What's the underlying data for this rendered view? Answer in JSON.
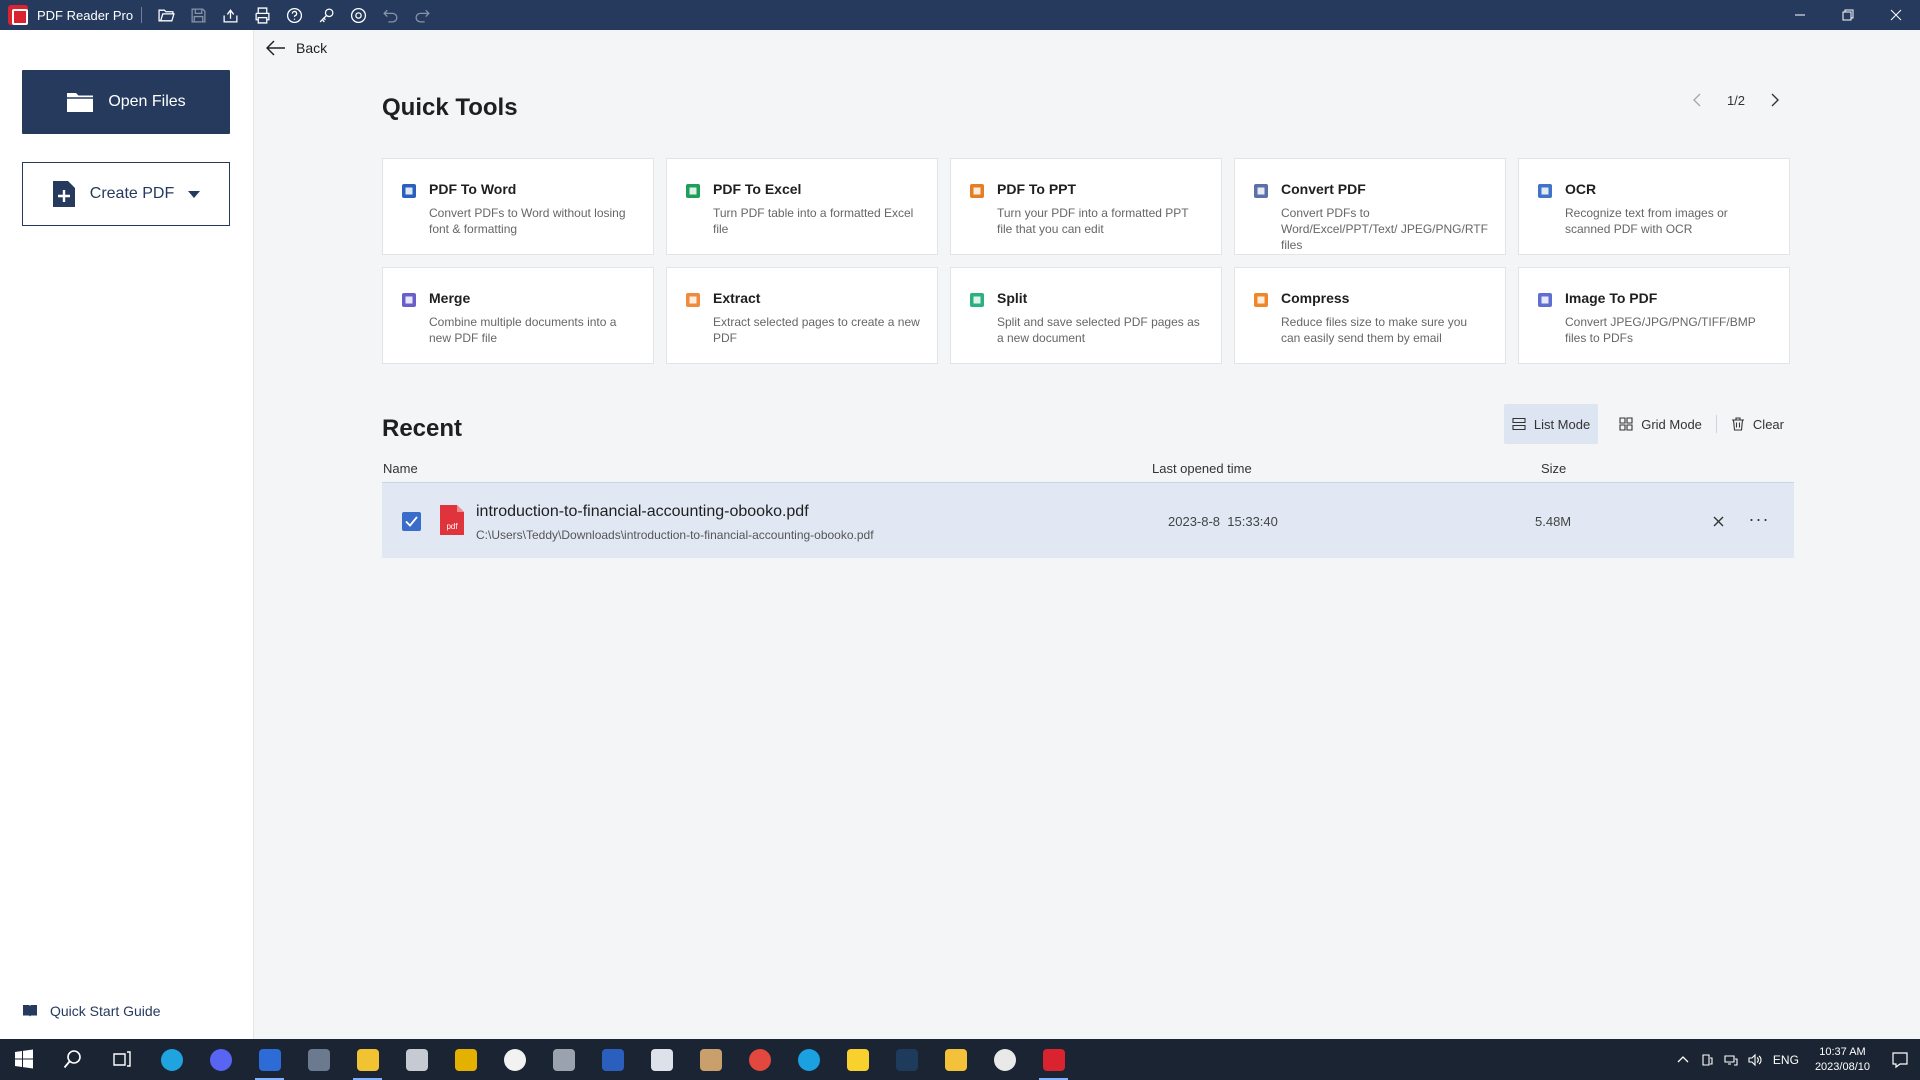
{
  "app": {
    "title": "PDF Reader Pro"
  },
  "toolbar": {
    "icons": [
      "open-folder-icon",
      "save-icon",
      "share-icon",
      "print-icon",
      "help-icon",
      "key-icon",
      "settings-icon",
      "undo-icon",
      "redo-icon"
    ]
  },
  "sidebar": {
    "open_files": "Open Files",
    "create_pdf": "Create PDF",
    "quick_start": "Quick Start Guide"
  },
  "main": {
    "back": "Back",
    "quick_tools_title": "Quick Tools",
    "pager": "1/2",
    "tools": [
      {
        "name": "PDF To Word",
        "desc": "Convert PDFs to Word without losing font & formatting",
        "icon": "word-icon",
        "color": "#2b5fbd"
      },
      {
        "name": "PDF To Excel",
        "desc": "Turn PDF table into a formatted Excel file",
        "icon": "excel-icon",
        "color": "#1e9e5a"
      },
      {
        "name": "PDF To PPT",
        "desc": "Turn your PDF into a formatted PPT file that you can edit",
        "icon": "ppt-icon",
        "color": "#e67d22"
      },
      {
        "name": "Convert PDF",
        "desc": "Convert PDFs to Word/Excel/PPT/Text/ JPEG/PNG/RTF files",
        "icon": "convert-icon",
        "color": "#5b6fa8"
      },
      {
        "name": "OCR",
        "desc": "Recognize text from images or scanned PDF with OCR",
        "icon": "ocr-icon",
        "color": "#3f74c9"
      },
      {
        "name": "Merge",
        "desc": "Combine multiple documents into a new PDF file",
        "icon": "merge-icon",
        "color": "#6a5fc9"
      },
      {
        "name": "Extract",
        "desc": "Extract selected pages to create a new PDF",
        "icon": "extract-icon",
        "color": "#f08a3c"
      },
      {
        "name": "Split",
        "desc": "Split and save selected PDF pages as a new document",
        "icon": "split-icon",
        "color": "#2bb07f"
      },
      {
        "name": "Compress",
        "desc": "Reduce files size to make sure you can easily send them by email",
        "icon": "compress-icon",
        "color": "#f0862a"
      },
      {
        "name": "Image To PDF",
        "desc": "Convert JPEG/JPG/PNG/TIFF/BMP files to PDFs",
        "icon": "image-icon",
        "color": "#5f6fd1"
      }
    ],
    "recent_title": "Recent",
    "modes": {
      "list": "List Mode",
      "grid": "Grid Mode",
      "clear": "Clear"
    },
    "columns": {
      "name": "Name",
      "time": "Last opened time",
      "size": "Size"
    },
    "recent": [
      {
        "name": "introduction-to-financial-accounting-obooko.pdf",
        "path": "C:\\Users\\Teddy\\Downloads\\introduction-to-financial-accounting-obooko.pdf",
        "time": "2023-8-8  15:33:40",
        "size": "5.48M",
        "checked": true
      }
    ],
    "file_badge": "pdf"
  },
  "taskbar": {
    "apps": [
      {
        "name": "windows-start-icon",
        "color": "#ffffff"
      },
      {
        "name": "search-icon",
        "color": "#ffffff"
      },
      {
        "name": "task-view-icon",
        "color": "#ffffff"
      },
      {
        "name": "edge-icon",
        "color": "#1fa4e0"
      },
      {
        "name": "discord-icon",
        "color": "#5865f2"
      },
      {
        "name": "terminal-icon",
        "color": "#2d6bd6"
      },
      {
        "name": "calculator-icon",
        "color": "#6c7a8f"
      },
      {
        "name": "file-explorer-icon",
        "color": "#f1c232"
      },
      {
        "name": "app-icon",
        "color": "#c6cbd3"
      },
      {
        "name": "app-yellow-icon",
        "color": "#e4b100"
      },
      {
        "name": "itunes-icon",
        "color": "#f2f2f2"
      },
      {
        "name": "app-gray-icon",
        "color": "#9aa3ad"
      },
      {
        "name": "word-icon",
        "color": "#2b5fbd"
      },
      {
        "name": "app-terminal-icon",
        "color": "#dde2ea"
      },
      {
        "name": "potato-icon",
        "color": "#c9a06b"
      },
      {
        "name": "chrome-icon",
        "color": "#e2483d"
      },
      {
        "name": "skype-icon",
        "color": "#1ba0e0"
      },
      {
        "name": "sticky-notes-icon",
        "color": "#f8d12f"
      },
      {
        "name": "steam-icon",
        "color": "#1e3b5c"
      },
      {
        "name": "paw-icon",
        "color": "#f3c13a"
      },
      {
        "name": "slack-icon",
        "color": "#e9e9e9"
      },
      {
        "name": "pdf-reader-pro-icon",
        "color": "#d9232f"
      }
    ],
    "lang": "ENG",
    "time": "10:37 AM",
    "date": "2023/08/10"
  }
}
